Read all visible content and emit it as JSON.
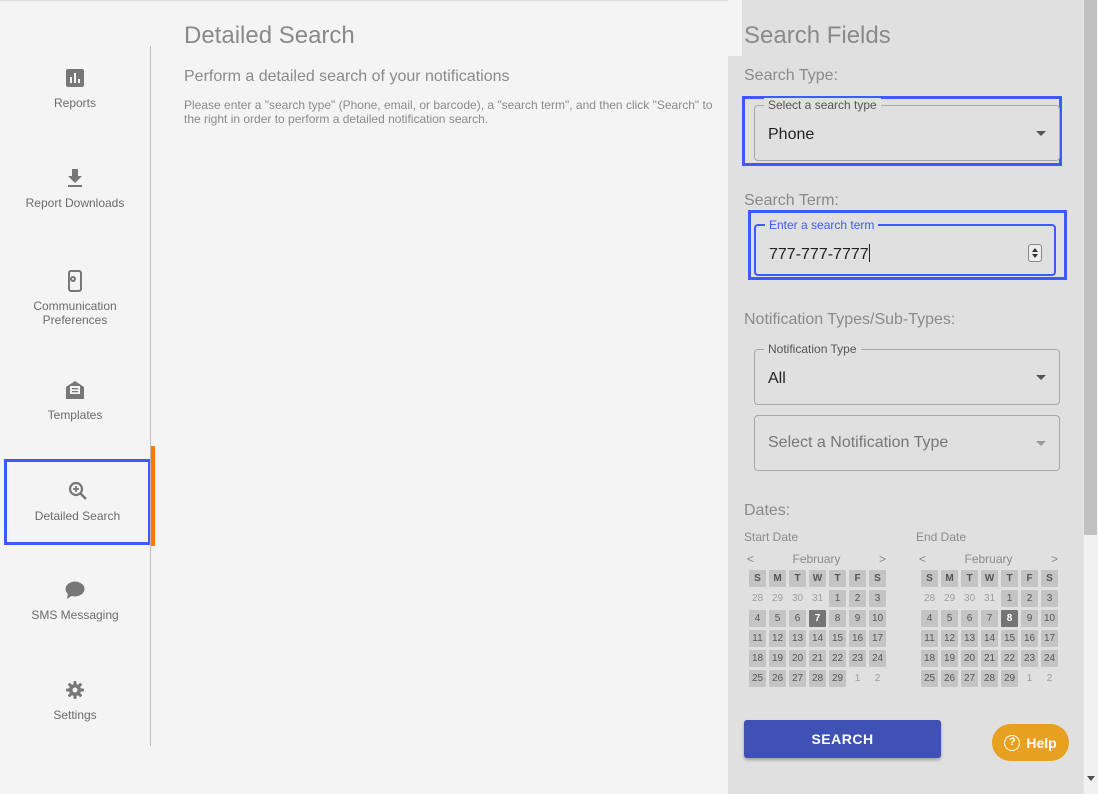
{
  "sidebar": {
    "items": [
      {
        "label": "Reports",
        "icon": "bar-chart-icon"
      },
      {
        "label": "Report Downloads",
        "icon": "download-icon"
      },
      {
        "label": "Communication Preferences",
        "icon": "phone-settings-icon"
      },
      {
        "label": "Templates",
        "icon": "envelope-icon"
      },
      {
        "label": "Detailed Search",
        "icon": "zoom-in-icon",
        "active": true
      },
      {
        "label": "SMS Messaging",
        "icon": "chat-bubble-icon"
      },
      {
        "label": "Settings",
        "icon": "gear-icon"
      }
    ]
  },
  "main": {
    "title": "Detailed Search",
    "subtitle": "Perform a detailed search of your notifications",
    "instructions": "Please enter a \"search type\" (Phone, email, or barcode), a \"search term\", and then click \"Search\" to the right in order to perform a detailed notification search."
  },
  "panel": {
    "title": "Search Fields",
    "search_type_label": "Search Type:",
    "search_type_legend": "Select a search type",
    "search_type_value": "Phone",
    "search_term_label": "Search Term:",
    "search_term_legend": "Enter a search term",
    "search_term_value": "777-777-7777",
    "notification_label": "Notification Types/Sub-Types:",
    "notification_type_legend": "Notification Type",
    "notification_type_value": "All",
    "notification_subtype_placeholder": "Select a Notification Type",
    "dates_label": "Dates:",
    "search_button": "SEARCH"
  },
  "calendars": [
    {
      "label": "Start Date",
      "month": "February",
      "prev": "<",
      "next": ">",
      "weekdays": [
        "S",
        "M",
        "T",
        "W",
        "T",
        "F",
        "S"
      ],
      "days": [
        "28",
        "29",
        "30",
        "31",
        "1",
        "2",
        "3",
        "4",
        "5",
        "6",
        "7",
        "8",
        "9",
        "10",
        "11",
        "12",
        "13",
        "14",
        "15",
        "16",
        "17",
        "18",
        "19",
        "20",
        "21",
        "22",
        "23",
        "24",
        "25",
        "26",
        "27",
        "28",
        "29",
        "1",
        "2"
      ],
      "muted": [
        0,
        1,
        2,
        3,
        33,
        34
      ],
      "selected": 10
    },
    {
      "label": "End Date",
      "month": "February",
      "prev": "<",
      "next": ">",
      "weekdays": [
        "S",
        "M",
        "T",
        "W",
        "T",
        "F",
        "S"
      ],
      "days": [
        "28",
        "29",
        "30",
        "31",
        "1",
        "2",
        "3",
        "4",
        "5",
        "6",
        "7",
        "8",
        "9",
        "10",
        "11",
        "12",
        "13",
        "14",
        "15",
        "16",
        "17",
        "18",
        "19",
        "20",
        "21",
        "22",
        "23",
        "24",
        "25",
        "26",
        "27",
        "28",
        "29",
        "1",
        "2"
      ],
      "muted": [
        0,
        1,
        2,
        3,
        33,
        34
      ],
      "selected": 11
    }
  ],
  "help": {
    "label": "Help",
    "icon_glyph": "?"
  },
  "colors": {
    "accent": "#3f51b5",
    "highlight": "#3d5afe",
    "active_bar": "#f57c00",
    "help": "#e8a020"
  }
}
